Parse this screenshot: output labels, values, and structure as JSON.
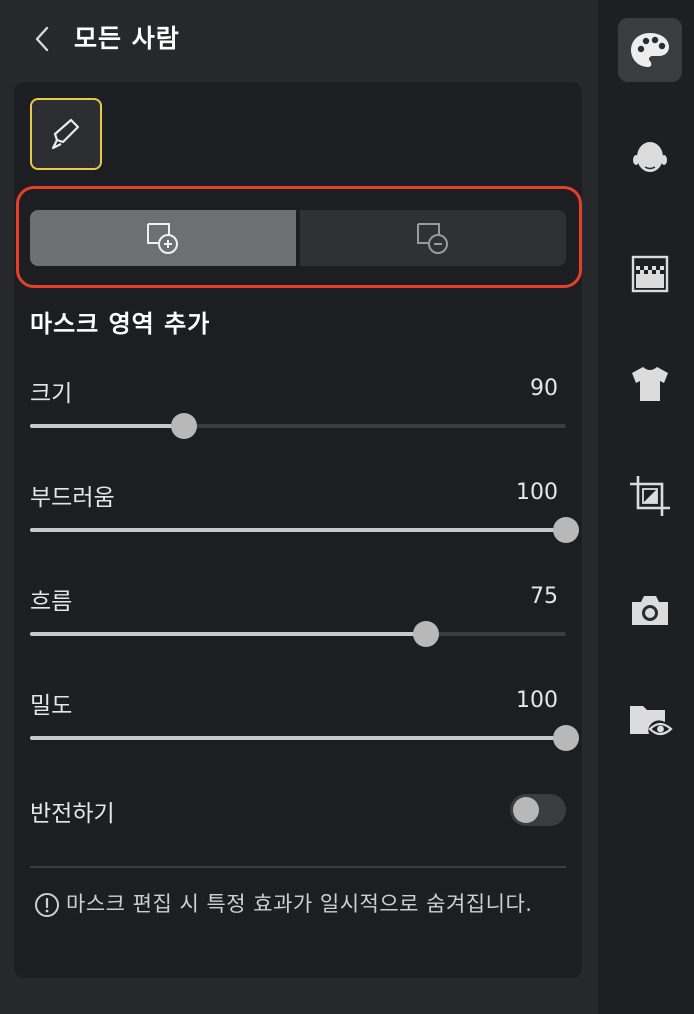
{
  "header": {
    "title": "모든 사람",
    "back_icon": "chevron-left-icon"
  },
  "tools": {
    "brush_icon": "brush-icon",
    "brush_selected": true
  },
  "mask_mode": {
    "options": [
      {
        "icon": "mask-add-icon",
        "selected": true
      },
      {
        "icon": "mask-subtract-icon",
        "selected": false
      }
    ],
    "highlight_color": "#e2402b"
  },
  "section": {
    "title": "마스크 영역 추가"
  },
  "sliders": [
    {
      "label": "크기",
      "value": "90",
      "fraction": 0.287
    },
    {
      "label": "부드러움",
      "value": "100",
      "fraction": 1.0
    },
    {
      "label": "흐름",
      "value": "75",
      "fraction": 0.738
    },
    {
      "label": "밀도",
      "value": "100",
      "fraction": 1.0
    }
  ],
  "invert": {
    "label": "반전하기",
    "on": false
  },
  "notice": {
    "icon": "info-circle-icon",
    "text": "마스크 편집 시 특정 효과가 일시적으로 숨겨집니다."
  },
  "right_bar": [
    {
      "icon": "palette-icon",
      "active": true
    },
    {
      "icon": "face-icon",
      "active": false
    },
    {
      "icon": "background-icon",
      "active": false
    },
    {
      "icon": "tshirt-icon",
      "active": false
    },
    {
      "icon": "crop-icon",
      "active": false
    },
    {
      "icon": "camera-icon",
      "active": false
    },
    {
      "icon": "folder-eye-icon",
      "active": false
    }
  ],
  "colors": {
    "accent_yellow": "#e9c94a",
    "highlight_red": "#e2402b"
  }
}
